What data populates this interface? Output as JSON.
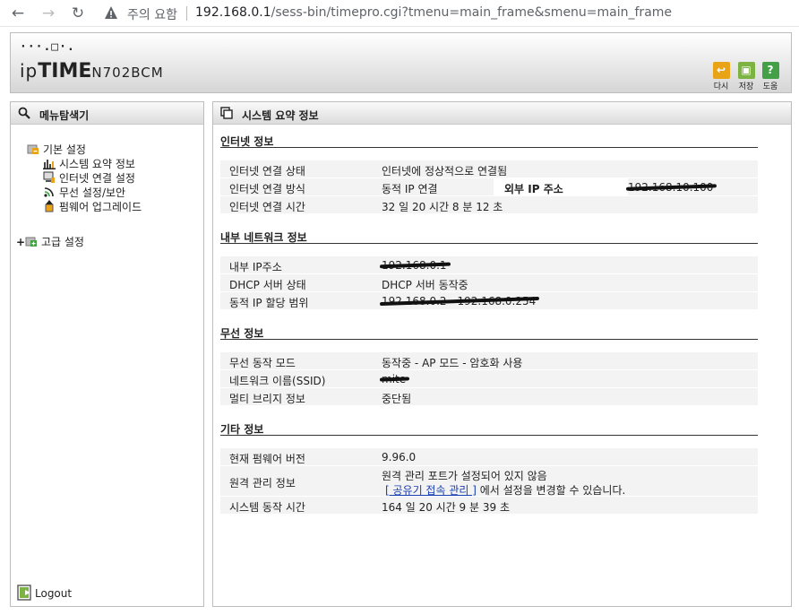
{
  "browser": {
    "warning_text": "주의 요함",
    "url_host": "192.168.0.1",
    "url_path": "/sess-bin/timepro.cgi?tmenu=main_frame&smenu=main_frame"
  },
  "header": {
    "logo_dots": "···.□·.",
    "logo_ip": "ip",
    "logo_time": "TIME",
    "logo_model": "N702BCM",
    "tools": [
      {
        "label": "다시",
        "icon": "back-icon",
        "color": "#e8a317"
      },
      {
        "label": "저장",
        "icon": "save-icon",
        "color": "#7cb342"
      },
      {
        "label": "도움",
        "icon": "help-icon",
        "color": "#43a047"
      }
    ]
  },
  "sidebar": {
    "title": "메뉴탐색기",
    "basic": {
      "label": "기본 설정",
      "items": [
        {
          "label": "시스템 요약 정보",
          "icon": "chart-icon"
        },
        {
          "label": "인터넷 연결 설정",
          "icon": "computer-icon"
        },
        {
          "label": "무선 설정/보안",
          "icon": "wireless-icon"
        },
        {
          "label": "펌웨어 업그레이드",
          "icon": "upgrade-icon"
        }
      ]
    },
    "advanced": {
      "expander": "+",
      "label": "고급 설정"
    },
    "logout": "Logout"
  },
  "main": {
    "title": "시스템 요약 정보",
    "internet": {
      "title": "인터넷 정보",
      "rows": [
        {
          "key": "인터넷 연결 상태",
          "value": "인터넷에 정상적으로 연결됨"
        },
        {
          "key": "인터넷 연결 방식",
          "value": "동적 IP 연결",
          "key2": "외부 IP 주소",
          "value2": "192.168.10.100"
        },
        {
          "key": "인터넷 연결 시간",
          "value": "32 일 20 시간 8 분 12 초"
        }
      ]
    },
    "lan": {
      "title": "내부 네트워크 정보",
      "rows": [
        {
          "key": "내부 IP주소",
          "value": "192.168.0.1"
        },
        {
          "key": "DHCP 서버 상태",
          "value": "DHCP 서버 동작중"
        },
        {
          "key": "동적 IP 할당 범위",
          "value": "192.168.0.2 - 192.168.0.254"
        }
      ]
    },
    "wireless": {
      "title": "무선 정보",
      "rows": [
        {
          "key": "무선 동작 모드",
          "value": "동작중 - AP 모드 - 암호화 사용"
        },
        {
          "key": "네트워크 이름(SSID)",
          "value": "mite"
        },
        {
          "key": "멀티 브리지 정보",
          "value": "중단됨"
        }
      ]
    },
    "etc": {
      "title": "기타 정보",
      "firmware_key": "현재 펌웨어 버전",
      "firmware_value": "9.96.0",
      "remote_key": "원격 관리 정보",
      "remote_line1": "원격 관리 포트가 설정되어 있지 않음",
      "remote_link": "[ 공유기 접속 관리 ]",
      "remote_line2": " 에서 설정을 변경할 수 있습니다.",
      "uptime_key": "시스템 동작 시간",
      "uptime_value": "164 일 20 시간 9 분 39 초"
    }
  }
}
